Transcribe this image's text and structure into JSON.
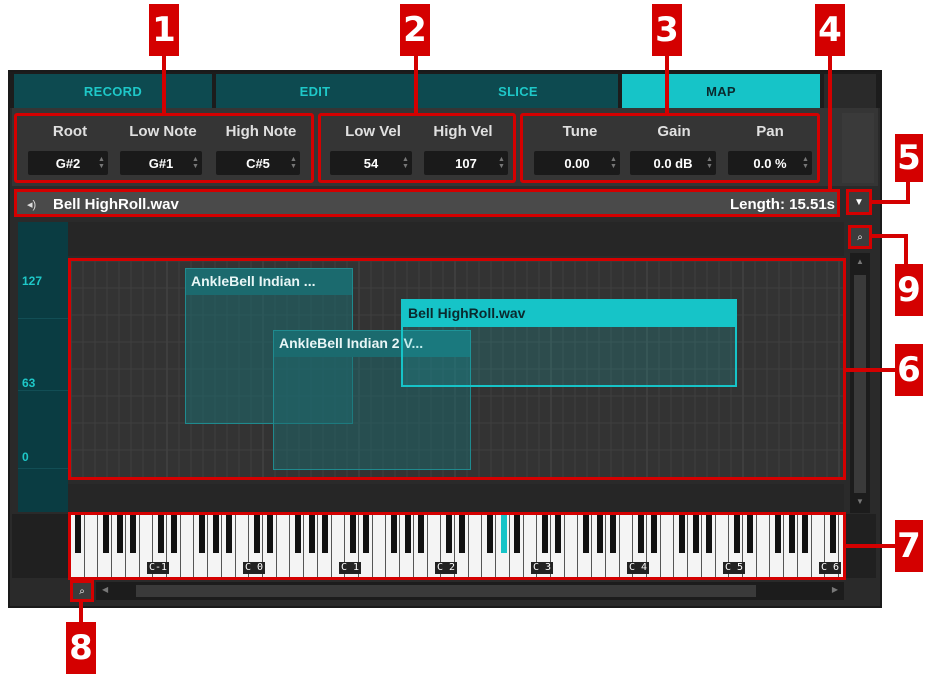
{
  "tabs": [
    {
      "label": "RECORD"
    },
    {
      "label": "EDIT"
    },
    {
      "label": "SLICE"
    },
    {
      "label": "MAP",
      "active": true
    }
  ],
  "params": {
    "root": {
      "label": "Root",
      "value": "G#2"
    },
    "low_note": {
      "label": "Low Note",
      "value": "G#1"
    },
    "high_note": {
      "label": "High Note",
      "value": "C#5"
    },
    "low_vel": {
      "label": "Low Vel",
      "value": "54"
    },
    "high_vel": {
      "label": "High Vel",
      "value": "107"
    },
    "tune": {
      "label": "Tune",
      "value": "0.00"
    },
    "gain": {
      "label": "Gain",
      "value": "0.0 dB"
    },
    "pan": {
      "label": "Pan",
      "value": "0.0 %"
    }
  },
  "sample": {
    "filename": "Bell HighRoll.wav",
    "length": "Length: 15.51s"
  },
  "velocity_labels": [
    "127",
    "63",
    "0"
  ],
  "zones": [
    {
      "label": "AnkleBell Indian ..."
    },
    {
      "label": "AnkleBell Indian 2 V..."
    },
    {
      "label": "Bell HighRoll.wav",
      "selected": true
    }
  ],
  "octaves": [
    "C-1",
    "C 0",
    "C 1",
    "C 2",
    "C 3",
    "C 4",
    "C 5",
    "C 6"
  ],
  "callouts": [
    "1",
    "2",
    "3",
    "4",
    "5",
    "6",
    "7",
    "8",
    "9"
  ],
  "colors": {
    "accent": "#16c4c8",
    "callout": "#d40000",
    "zone": "#1b6a6e"
  },
  "icons": [
    "speaker-icon",
    "dropdown-arrow-icon",
    "zoom-icon",
    "scroll-up-arrow-icon",
    "scroll-down-arrow-icon",
    "scroll-left-arrow-icon",
    "scroll-right-arrow-icon"
  ]
}
